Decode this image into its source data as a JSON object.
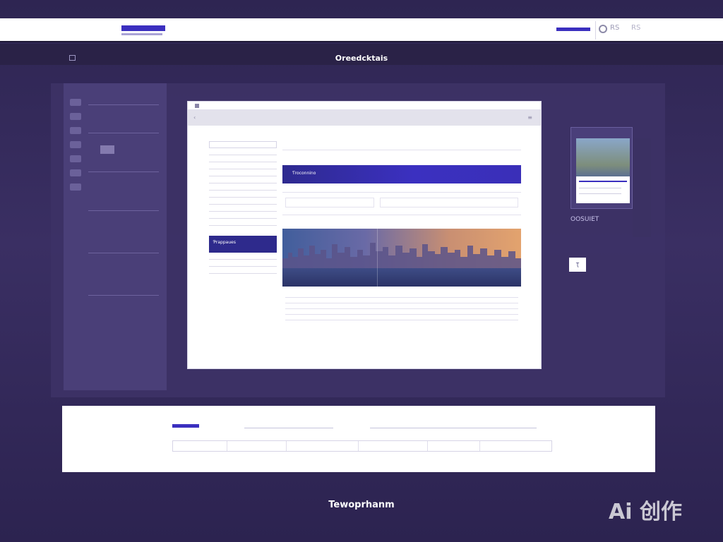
{
  "header": {
    "lang_label": "RS",
    "user_label": "RS"
  },
  "band": {
    "mini_text": "",
    "crumb_text": "",
    "center_title": "Oreedcktais"
  },
  "main_window": {
    "page_title": "",
    "hero_label": "Ƭroconnino",
    "side_active_label": "Ƥrappaues"
  },
  "preview": {
    "title": "",
    "caption": "OOSUIET"
  },
  "small_button": {
    "label": "Ʈ"
  },
  "footer": {
    "title": "Tewoprhanm"
  },
  "watermark": {
    "text": "Ai 创作"
  },
  "colors": {
    "accent": "#3b2fbf",
    "background": "#2e2552",
    "panel": "#ffffff"
  }
}
